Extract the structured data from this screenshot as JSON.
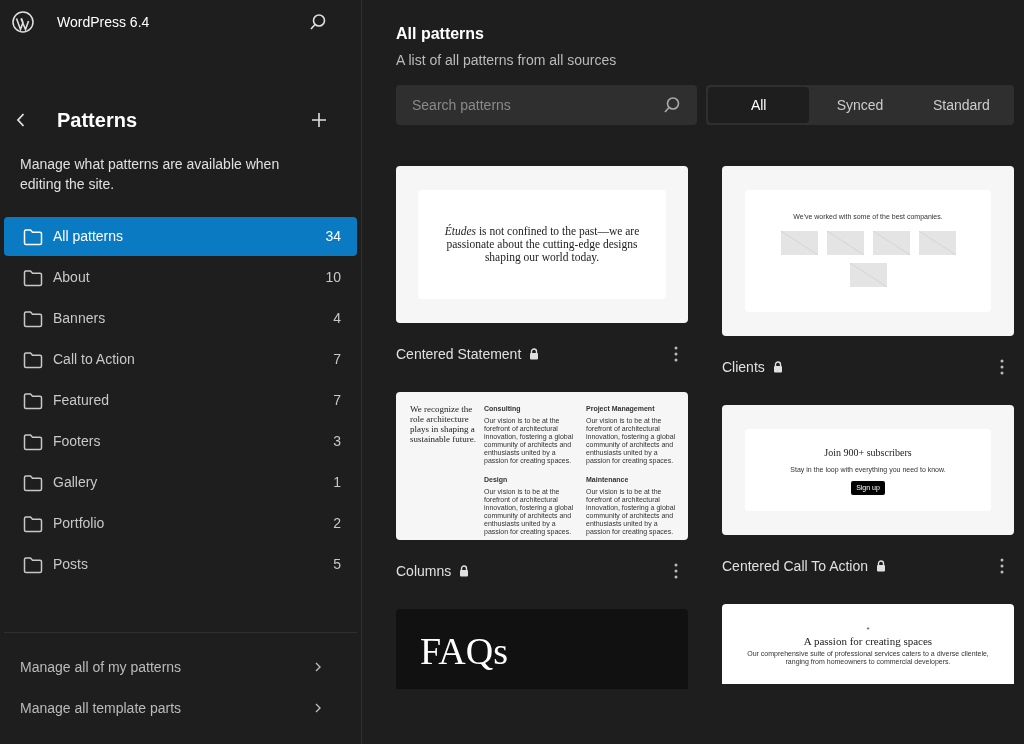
{
  "site": {
    "title": "WordPress 6.4"
  },
  "sidebar": {
    "title": "Patterns",
    "description": "Manage what patterns are available when editing the site.",
    "categories": [
      {
        "label": "All patterns",
        "count": "34",
        "selected": true
      },
      {
        "label": "About",
        "count": "10",
        "selected": false
      },
      {
        "label": "Banners",
        "count": "4",
        "selected": false
      },
      {
        "label": "Call to Action",
        "count": "7",
        "selected": false
      },
      {
        "label": "Featured",
        "count": "7",
        "selected": false
      },
      {
        "label": "Footers",
        "count": "3",
        "selected": false
      },
      {
        "label": "Gallery",
        "count": "1",
        "selected": false
      },
      {
        "label": "Portfolio",
        "count": "2",
        "selected": false
      },
      {
        "label": "Posts",
        "count": "5",
        "selected": false
      }
    ],
    "links": [
      "Manage all of my patterns",
      "Manage all template parts"
    ]
  },
  "main": {
    "title": "All patterns",
    "subtitle": "A list of all patterns from all sources",
    "search": {
      "placeholder": "Search patterns"
    },
    "filters": [
      {
        "label": "All",
        "selected": true
      },
      {
        "label": "Synced",
        "selected": false
      },
      {
        "label": "Standard",
        "selected": false
      }
    ],
    "columns": [
      [
        {
          "title": "Centered Statement",
          "locked": true,
          "preview": {
            "kind": "statement",
            "text": "*Études* is not confined to the past—we are passionate about the cutting-edge designs shaping our world today."
          }
        },
        {
          "title": "Columns",
          "locked": true,
          "preview": {
            "kind": "columns",
            "heading": "We recognize the role architecture plays in shaping a sustainable future.",
            "items": [
              {
                "title": "Consulting",
                "body": "Our vision is to be at the forefront of architectural innovation, fostering a global community of architects and enthusiasts united by a passion for creating spaces."
              },
              {
                "title": "Project Management",
                "body": "Our vision is to be at the forefront of architectural innovation, fostering a global community of architects and enthusiasts united by a passion for creating spaces."
              },
              {
                "title": "Design",
                "body": "Our vision is to be at the forefront of architectural innovation, fostering a global community of architects and enthusiasts united by a passion for creating spaces."
              },
              {
                "title": "Maintenance",
                "body": "Our vision is to be at the forefront of architectural innovation, fostering a global community of architects and enthusiasts united by a passion for creating spaces."
              }
            ]
          }
        },
        {
          "preview": {
            "kind": "dark_title",
            "heading": "FAQs"
          }
        }
      ],
      [
        {
          "title": "Clients",
          "locked": true,
          "preview": {
            "kind": "logos",
            "heading": "We've worked with some of the best companies."
          }
        },
        {
          "title": "Centered Call To Action",
          "locked": true,
          "preview": {
            "kind": "cta",
            "heading": "Join 900+ subscribers",
            "text": "Stay in the loop with everything you need to know.",
            "button": "Sign up"
          }
        },
        {
          "preview": {
            "kind": "hero",
            "mark": "*",
            "heading": "A passion for creating spaces",
            "text": "Our comprehensive suite of professional services caters to a diverse clientele, ranging from homeowners to commercial developers."
          }
        }
      ]
    ]
  }
}
